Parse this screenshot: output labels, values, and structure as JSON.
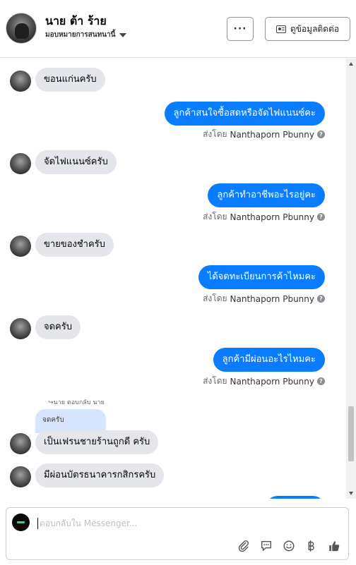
{
  "header": {
    "name": "นาย ต้า ร้าย",
    "subtitle": "มอบหมายการสนทนานี้",
    "more_label": "···",
    "contact_label": "ดูข้อมูลติดต่อ"
  },
  "sent_by_prefix": "ส่งโดย",
  "sent_by_name": "Nanthaporn Pbunny",
  "messages": [
    {
      "side": "in",
      "text": "ขอนแก่นครับ"
    },
    {
      "side": "out",
      "text": "ลูกค้าสนใจซื้อสดหรือจัดไฟแนนซ์คะ"
    },
    {
      "side": "in",
      "text": "จัดไฟแนนซ์ครับ"
    },
    {
      "side": "out",
      "text": "ลูกค้าทำอาชีพอะไรอยู่คะ"
    },
    {
      "side": "in",
      "text": "ขายของชำครับ"
    },
    {
      "side": "out",
      "text": "ได้จดทะเบียนการค้าไหมคะ"
    },
    {
      "side": "in",
      "text": "จดครับ"
    },
    {
      "side": "out",
      "text": "ลูกค้ามีผ่อนอะไรไหมคะ"
    },
    {
      "side": "in",
      "text": "เป็นเฟรนชายร้านถูกดี ครับ"
    },
    {
      "side": "in",
      "text": "มีผ่อนบัตรธนาคารกสิกรครับ"
    }
  ],
  "reply": {
    "note": "นาย ตอบกลับ นาย",
    "quoted_text": "จดครับ"
  },
  "composer": {
    "placeholder": "ตอบกลับใน Messenger..."
  },
  "icons": [
    "attach-icon",
    "saved-reply-icon",
    "emoji-icon",
    "baht-icon",
    "thumbs-up-icon"
  ],
  "colors": {
    "outgoing": "#0a7cff",
    "incoming": "#e4e6eb",
    "quoted": "#d6e5fd"
  }
}
